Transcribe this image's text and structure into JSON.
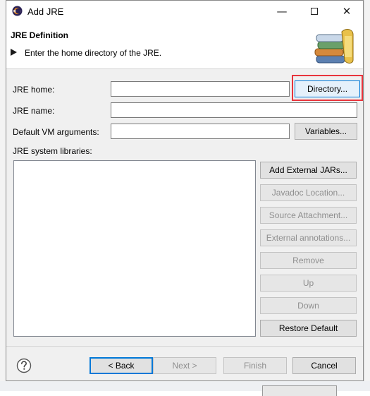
{
  "window": {
    "title": "Add JRE",
    "minimize_glyph": "—",
    "close_glyph": "✕"
  },
  "header": {
    "title": "JRE Definition",
    "message": "Enter the home directory of the JRE."
  },
  "form": {
    "jre_home_label": "JRE home:",
    "jre_home_value": "",
    "directory_button": "Directory...",
    "jre_name_label": "JRE name:",
    "jre_name_value": "",
    "vm_args_label": "Default VM arguments:",
    "vm_args_value": "",
    "variables_button": "Variables...",
    "libraries_label": "JRE system libraries:"
  },
  "library_buttons": [
    {
      "label": "Add External JARs...",
      "enabled": true
    },
    {
      "label": "Javadoc Location...",
      "enabled": false
    },
    {
      "label": "Source Attachment...",
      "enabled": false
    },
    {
      "label": "External annotations...",
      "enabled": false
    },
    {
      "label": "Remove",
      "enabled": false
    },
    {
      "label": "Up",
      "enabled": false
    },
    {
      "label": "Down",
      "enabled": false
    },
    {
      "label": "Restore Default",
      "enabled": true
    }
  ],
  "footer": {
    "back": "< Back",
    "next": "Next >",
    "finish": "Finish",
    "cancel": "Cancel"
  },
  "colors": {
    "highlight_frame": "#e8343c",
    "focus_blue": "#0078d7"
  },
  "icons": {
    "app": "eclipse-icon",
    "help": "help-icon",
    "header_image": "books-jre-icon",
    "info": "info-arrow-icon"
  }
}
